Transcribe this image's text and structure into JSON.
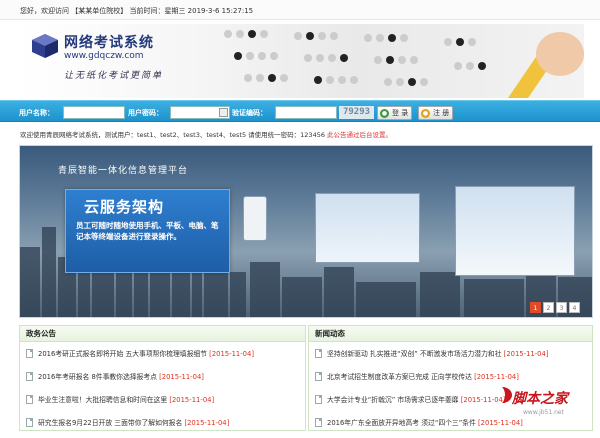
{
  "topbar": {
    "text": "您好，欢迎访问 【某某单位院校】  当前时间：星期三 2019-3-6 15:27:15"
  },
  "banner": {
    "title": "网络考试系统",
    "url": "www.gdqczw.com",
    "slogan": "让无纸化考试更简单"
  },
  "login": {
    "username_label": "用户名称：",
    "password_label": "用户密码：",
    "captcha_label": "验证编码：",
    "captcha_value": "79293",
    "login_button": "登 录",
    "register_button": "注 册",
    "username_value": "",
    "password_value": "",
    "captcha_input_value": ""
  },
  "notice": {
    "text_prefix": "欢迎使用青辰网络考试系统，测试用户：test1、test2、test3、test4、test5 请使用统一密码：123456 ",
    "text_red": "此公告通过后台设置。"
  },
  "slide": {
    "platform_title": "青辰智能一体化信息管理平台",
    "cloud_title": "云服务架构",
    "cloud_desc": "员工可随时随地使用手机、平板、电脑、笔记本等终端设备进行登录操作。",
    "pages": [
      "1",
      "2",
      "3",
      "4"
    ],
    "active_page": "1"
  },
  "panels": {
    "left": {
      "title": "政务公告",
      "items": [
        {
          "title": "2016考研正式报名即将开始 五大事项帮你梳理填报细节",
          "date": "[2015-11-04]"
        },
        {
          "title": "2016年考研报名 8件事教你选择报考点",
          "date": "[2015-11-04]"
        },
        {
          "title": "毕业生注意啦！大批招聘信息和时间在这里",
          "date": "[2015-11-04]"
        },
        {
          "title": "研究生报名9月22日开放 三面带你了解如何报名",
          "date": "[2015-11-04]"
        }
      ]
    },
    "right": {
      "title": "新闻动态",
      "items": [
        {
          "title": "坚持创新驱动 扎实推进“双创” 不断激发市场活力潜力和社",
          "date": "[2015-11-04]"
        },
        {
          "title": "北京考试招生制度改革方案已完成 正向学校传达",
          "date": "[2015-11-04]"
        },
        {
          "title": "大学会计专业“折戟沉”  市场需求已逐年萎靡",
          "date": "[2015-11-04]"
        },
        {
          "title": "2016年广东全面放开异地高考 须过“四个三”条件",
          "date": "[2015-11-04]"
        }
      ]
    }
  },
  "watermark": {
    "text": "脚本之家",
    "url": "www.jb51.net"
  }
}
